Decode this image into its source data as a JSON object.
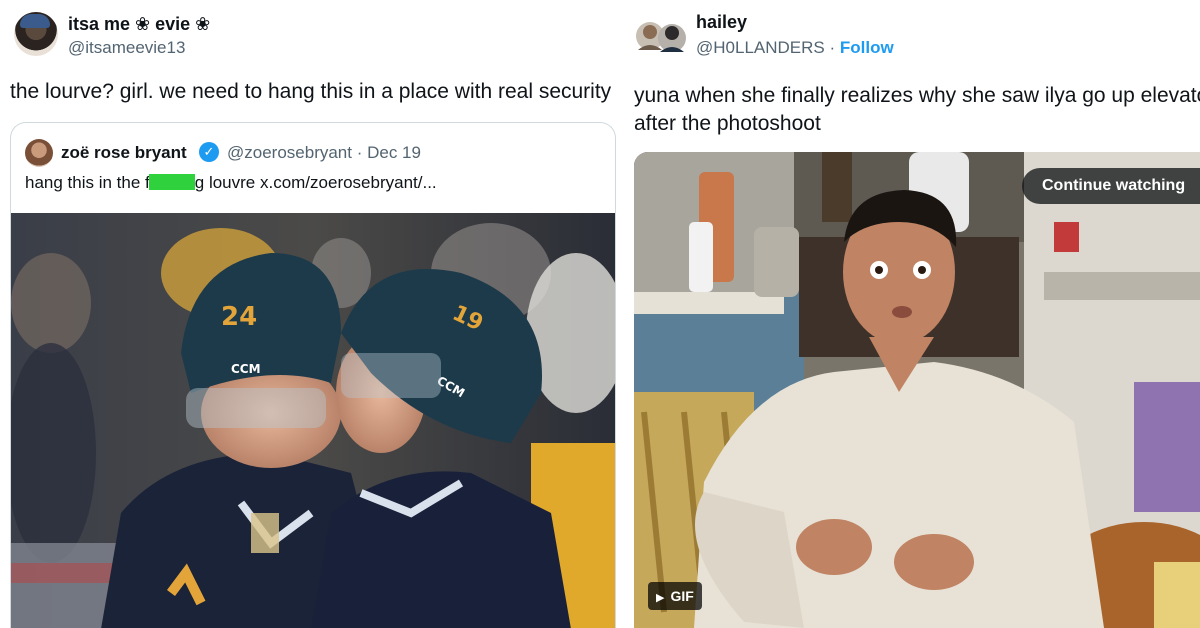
{
  "left_tweet": {
    "display_name": "itsa me ❀ evie ❀",
    "handle": "@itsameevie13",
    "text": "the lourve? girl. we need to hang this in a place with real security",
    "quoted": {
      "display_name": "zoë rose bryant",
      "handle_date": "@zoerosebryant · Dec 19",
      "text_before": "hang this in the f",
      "text_after": "g louvre  x.com/zoerosebryant/...",
      "image": {
        "jersey_number_1": "24",
        "helmet_brand": "CCM",
        "helmet_number_2": "19"
      }
    }
  },
  "right_tweet": {
    "display_name": "hailey",
    "handle": "@H0LLANDERS",
    "separator": " · ",
    "follow_label": "Follow",
    "text": "yuna when she finally realizes why she saw ilya go up elevator after the photoshoot",
    "continue_label": "Continue watching",
    "gif_label": "GIF"
  },
  "colors": {
    "link": "#1d9bf0",
    "secondary_text": "#536471",
    "censor_bar": "#2fd13d"
  }
}
